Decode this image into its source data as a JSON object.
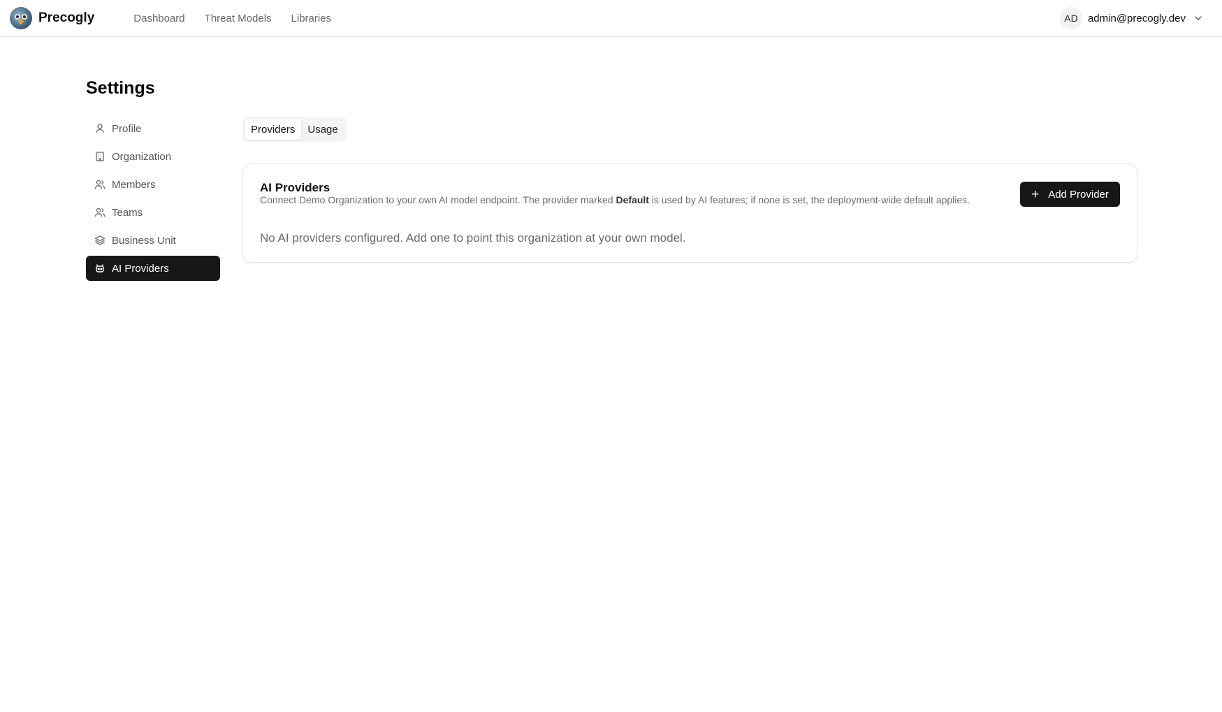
{
  "brand": {
    "name": "Precogly"
  },
  "nav": {
    "items": [
      "Dashboard",
      "Threat Models",
      "Libraries"
    ]
  },
  "user": {
    "initials": "AD",
    "email": "admin@precogly.dev"
  },
  "settings": {
    "title": "Settings",
    "sidebar": [
      {
        "label": "Profile",
        "icon": "user-icon"
      },
      {
        "label": "Organization",
        "icon": "building-icon"
      },
      {
        "label": "Members",
        "icon": "users-icon"
      },
      {
        "label": "Teams",
        "icon": "users-icon"
      },
      {
        "label": "Business Unit",
        "icon": "layers-icon"
      },
      {
        "label": "AI Providers",
        "icon": "bot-icon",
        "active": true
      }
    ],
    "tabs": [
      {
        "label": "Providers",
        "active": true
      },
      {
        "label": "Usage"
      }
    ]
  },
  "card": {
    "title": "AI Providers",
    "desc_pre": "Connect Demo Organization to your own AI model endpoint. The provider marked ",
    "desc_bold": "Default",
    "desc_post": " is used by AI features; if none is set, the deployment-wide default applies.",
    "add_button": "Add Provider",
    "empty_text": "No AI providers configured. Add one to point this organization at your own model."
  },
  "colors": {
    "accent": "#171717",
    "muted": "#6b6b6b",
    "border": "#e5e5e5"
  }
}
